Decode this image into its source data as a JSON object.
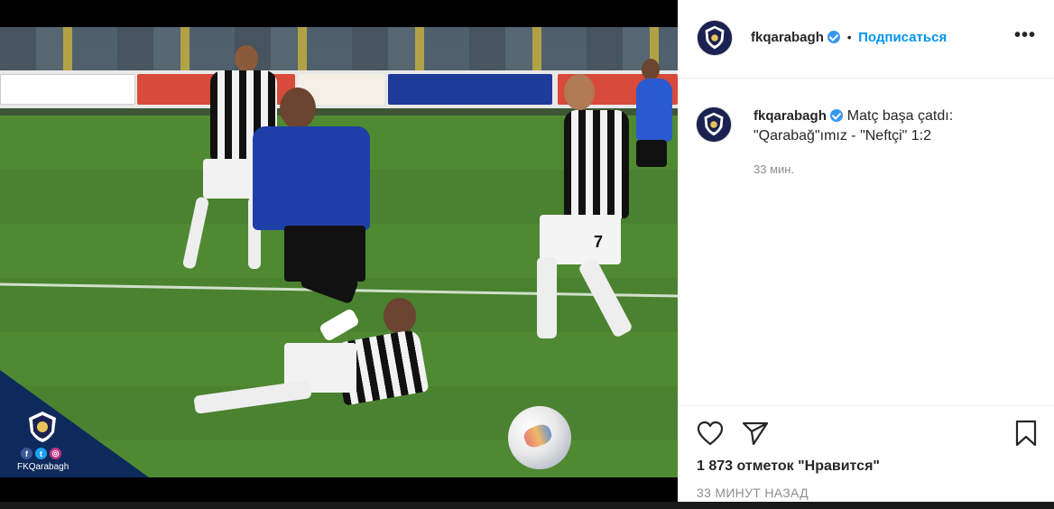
{
  "post": {
    "username": "fkqarabagh",
    "follow_separator": "•",
    "follow_label": "Подписаться",
    "more_label": "•••",
    "caption": "Matç başa çatdı: \"Qarabağ\"ımız - \"Neftçi\" 1:2",
    "caption_time": "33 мин.",
    "likes": "1 873 отметок \"Нравится\"",
    "posted_ago": "33 МИНУТ НАЗАД"
  },
  "media": {
    "watermark_text": "FKQarabagh",
    "social_icons": [
      "facebook-icon",
      "twitter-icon",
      "instagram-icon"
    ],
    "player_number": "7"
  },
  "colors": {
    "accent": "#0095f6",
    "verified": "#3897f0",
    "muted": "#8e8e8e",
    "text": "#262626"
  },
  "icons": {
    "like": "heart-icon",
    "share": "send-icon",
    "save": "bookmark-icon",
    "more": "more-dots-icon"
  }
}
